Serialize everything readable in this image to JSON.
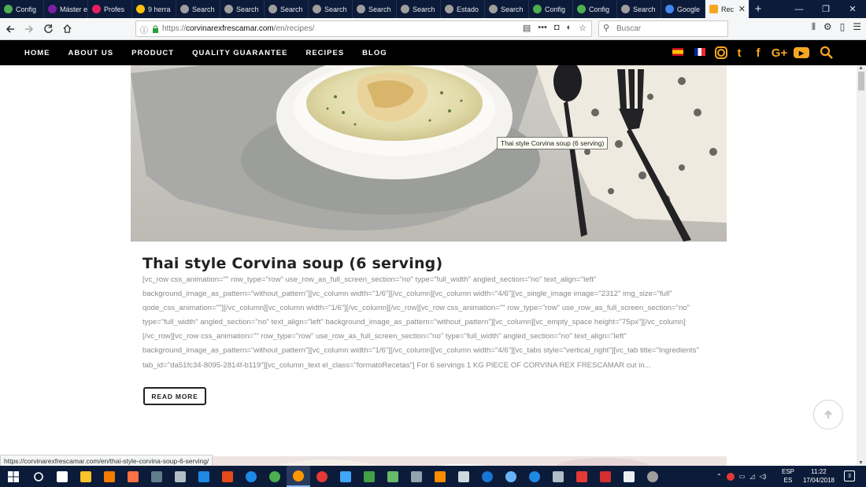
{
  "browser": {
    "tabs": [
      {
        "label": "Config",
        "color": "#4caf50"
      },
      {
        "label": "Máster en F",
        "color": "#7b1fa2"
      },
      {
        "label": "Profes",
        "color": "#e91e63"
      },
      {
        "label": "9 herra",
        "color": "#ffc107"
      },
      {
        "label": "Search",
        "color": "#9e9e9e"
      },
      {
        "label": "Search",
        "color": "#9e9e9e"
      },
      {
        "label": "Search",
        "color": "#9e9e9e"
      },
      {
        "label": "Search",
        "color": "#9e9e9e"
      },
      {
        "label": "Search",
        "color": "#9e9e9e"
      },
      {
        "label": "Search",
        "color": "#9e9e9e"
      },
      {
        "label": "Estado",
        "color": "#9e9e9e"
      },
      {
        "label": "Search",
        "color": "#9e9e9e"
      },
      {
        "label": "Config",
        "color": "#4caf50"
      },
      {
        "label": "Config",
        "color": "#4caf50"
      },
      {
        "label": "Search",
        "color": "#9e9e9e"
      },
      {
        "label": "Google",
        "color": "#4285f4"
      }
    ],
    "active_tab": {
      "label": "Rec",
      "close": "✕"
    },
    "new_tab": "+",
    "window": {
      "minimize": "—",
      "restore": "❐",
      "close": "✕"
    },
    "url": {
      "domain": "corvinarexfrescamar.com",
      "prefix": "https://",
      "path": "/en/recipes/"
    },
    "search_placeholder": "Buscar",
    "status_url": "https://corvinarexfrescamar.com/en/thai-style-corvina-soup-6-serving/"
  },
  "site": {
    "menu": [
      "HOME",
      "ABOUT US",
      "PRODUCT",
      "QUALITY GUARANTEE",
      "RECIPES",
      "BLOG"
    ],
    "accent_color": "#f5a623",
    "social_icons": [
      "instagram-icon",
      "twitter-icon",
      "facebook-icon",
      "google-plus-icon",
      "youtube-icon"
    ],
    "social_glyphs": {
      "twitter": "t",
      "facebook": "f",
      "gplus": "G+",
      "youtube": "▶"
    }
  },
  "post": {
    "image_tooltip": "Thai style Corvina soup (6 serving)",
    "title": "Thai style Corvina soup (6 serving)",
    "excerpt": "[vc_row css_animation=\"\" row_type=\"row\" use_row_as_full_screen_section=\"no\" type=\"full_width\" angled_section=\"no\" text_align=\"left\" background_image_as_pattern=\"without_pattern\"][vc_column width=\"1/6\"][/vc_column][vc_column width=\"4/6\"][vc_single_image image=\"2312\" img_size=\"full\" qode_css_animation=\"\"][/vc_column][vc_column width=\"1/6\"][/vc_column][/vc_row][vc_row css_animation=\"\" row_type=\"row\" use_row_as_full_screen_section=\"no\" type=\"full_width\" angled_section=\"no\" text_align=\"left\" background_image_as_pattern=\"without_pattern\"][vc_column][vc_empty_space height=\"75px\"][/vc_column][/vc_row][vc_row css_animation=\"\" row_type=\"row\" use_row_as_full_screen_section=\"no\" type=\"full_width\" angled_section=\"no\" text_align=\"left\" background_image_as_pattern=\"without_pattern\"][vc_column width=\"1/6\"][/vc_column][vc_column width=\"4/6\"][vc_tabs style=\"vertical_right\"][vc_tab title=\"Ingredients\" tab_id=\"da51fc34-8095-2814f-b119\"][vc_column_text el_class=\"formatoRecetas\"] For 6 servings 1 KG PIECE OF CORVINA REX FRESCAMAR cut in...",
    "read_more": "READ MORE"
  },
  "taskbar": {
    "apps": [
      {
        "name": "task-view",
        "color": "#ffffff"
      },
      {
        "name": "file-explorer",
        "color": "#f9c32b"
      },
      {
        "name": "vlc",
        "color": "#f57c00"
      },
      {
        "name": "app-orange",
        "color": "#ff7043"
      },
      {
        "name": "app-dark",
        "color": "#607d8b"
      },
      {
        "name": "app-bug",
        "color": "#b0bec5"
      },
      {
        "name": "app-blue",
        "color": "#1e88e5"
      },
      {
        "name": "app-fire",
        "color": "#e64a19"
      },
      {
        "name": "edge",
        "color": "#1e88e5"
      },
      {
        "name": "chrome",
        "color": "#4caf50"
      },
      {
        "name": "firefox",
        "color": "#ff9800"
      },
      {
        "name": "opera",
        "color": "#e53935"
      },
      {
        "name": "app-docs",
        "color": "#42a5f5"
      },
      {
        "name": "app-green",
        "color": "#43a047"
      },
      {
        "name": "app-diamond",
        "color": "#66bb6a"
      },
      {
        "name": "app-wrench",
        "color": "#90a4ae"
      },
      {
        "name": "app-orange2",
        "color": "#fb8c00"
      },
      {
        "name": "calculator",
        "color": "#cfd8dc"
      },
      {
        "name": "app-blue2",
        "color": "#1976d2"
      },
      {
        "name": "app-globe",
        "color": "#64b5f6"
      },
      {
        "name": "teamviewer",
        "color": "#1e88e5"
      },
      {
        "name": "app-cube",
        "color": "#b0bec5"
      },
      {
        "name": "app-red",
        "color": "#e53935"
      },
      {
        "name": "pdf",
        "color": "#d32f2f"
      },
      {
        "name": "notepad",
        "color": "#eceff1"
      },
      {
        "name": "app-gear",
        "color": "#9e9e9e"
      }
    ],
    "lang": {
      "top": "ESP",
      "bottom": "ES"
    },
    "time": "11:22",
    "date": "17/04/2018",
    "notifications": "3"
  }
}
